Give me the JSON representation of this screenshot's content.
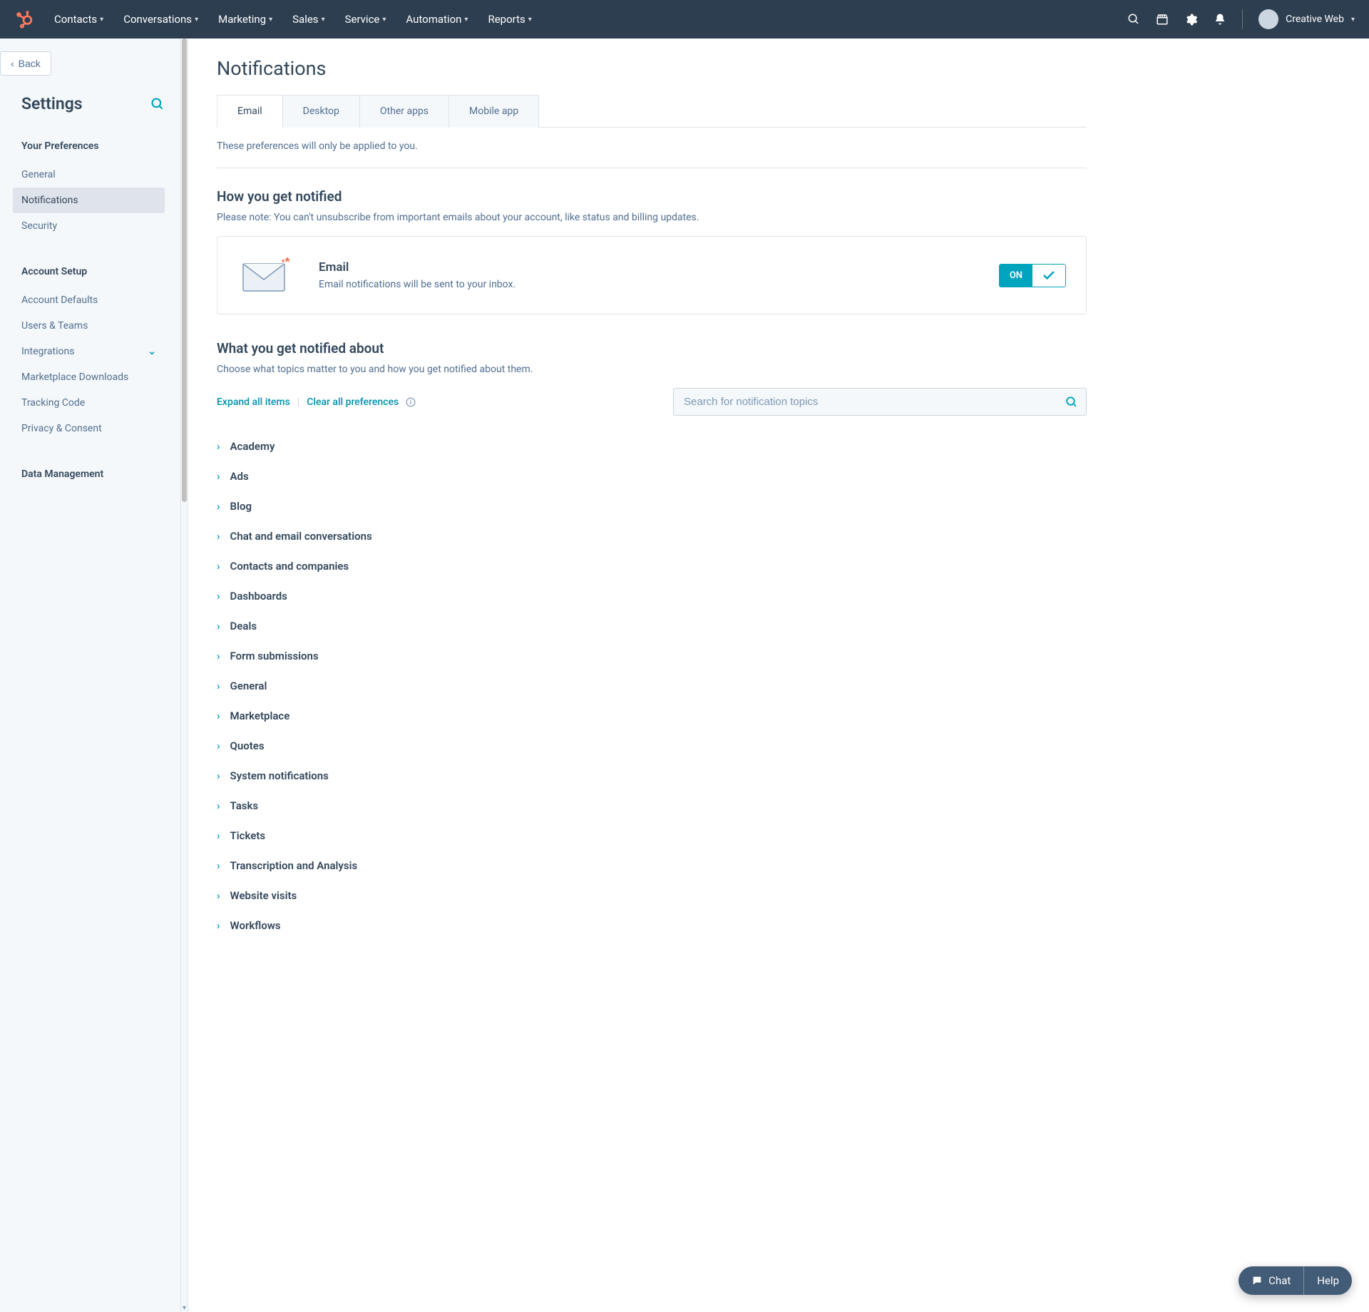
{
  "topnav": {
    "items": [
      "Contacts",
      "Conversations",
      "Marketing",
      "Sales",
      "Service",
      "Automation",
      "Reports"
    ],
    "account": "Creative Web"
  },
  "sidebar": {
    "back": "Back",
    "title": "Settings",
    "groups": [
      {
        "title": "Your Preferences",
        "items": [
          {
            "label": "General",
            "active": false
          },
          {
            "label": "Notifications",
            "active": true
          },
          {
            "label": "Security",
            "active": false
          }
        ]
      },
      {
        "title": "Account Setup",
        "items": [
          {
            "label": "Account Defaults"
          },
          {
            "label": "Users & Teams"
          },
          {
            "label": "Integrations",
            "expandable": true
          },
          {
            "label": "Marketplace Downloads"
          },
          {
            "label": "Tracking Code"
          },
          {
            "label": "Privacy & Consent"
          }
        ]
      },
      {
        "title": "Data Management",
        "items": []
      }
    ]
  },
  "content": {
    "page_title": "Notifications",
    "tabs": [
      {
        "label": "Email",
        "active": true
      },
      {
        "label": "Desktop"
      },
      {
        "label": "Other apps"
      },
      {
        "label": "Mobile app"
      }
    ],
    "applies_to_you": "These preferences will only be applied to you.",
    "how_notified": {
      "heading": "How you get notified",
      "note": "Please note: You can't unsubscribe from important emails about your account, like status and billing updates.",
      "card_title": "Email",
      "card_desc": "Email notifications will be sent to your inbox.",
      "toggle_on": "ON"
    },
    "what_about": {
      "heading": "What you get notified about",
      "note": "Choose what topics matter to you and how you get notified about them.",
      "expand": "Expand all items",
      "clear": "Clear all preferences",
      "search_placeholder": "Search for notification topics",
      "topics": [
        "Academy",
        "Ads",
        "Blog",
        "Chat and email conversations",
        "Contacts and companies",
        "Dashboards",
        "Deals",
        "Form submissions",
        "General",
        "Marketplace",
        "Quotes",
        "System notifications",
        "Tasks",
        "Tickets",
        "Transcription and Analysis",
        "Website visits",
        "Workflows"
      ]
    }
  },
  "chat": {
    "chat": "Chat",
    "help": "Help"
  }
}
